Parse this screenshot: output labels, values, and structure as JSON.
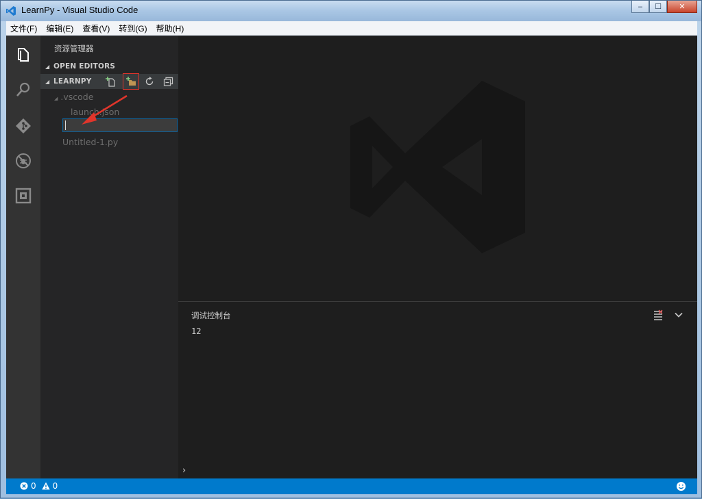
{
  "window": {
    "title": "LearnPy - Visual Studio Code",
    "controls": {
      "minimize": "‒",
      "maximize": "☐",
      "close": "✕"
    }
  },
  "menubar": [
    "文件(F)",
    "编辑(E)",
    "查看(V)",
    "转到(G)",
    "帮助(H)"
  ],
  "activitybar": [
    "explorer-icon",
    "search-icon",
    "git-icon",
    "debug-icon",
    "extensions-icon"
  ],
  "sidebar": {
    "header": "资源管理器",
    "open_editors_label": "OPEN EDITORS",
    "explorer_label": "LEARNPY",
    "tools": [
      "new-file-icon",
      "new-folder-icon",
      "refresh-icon",
      "collapse-all-icon"
    ],
    "tree": [
      {
        "label": ".vscode",
        "type": "folder"
      },
      {
        "label": "launch.json",
        "type": "file"
      },
      {
        "label": "Untitled-1.py",
        "type": "file"
      }
    ],
    "rename_value": ""
  },
  "panel": {
    "title": "调试控制台",
    "output": "12",
    "prompt": "›"
  },
  "statusbar": {
    "errors": "0",
    "warnings": "0"
  },
  "colors": {
    "accent": "#007acc",
    "activitybar": "#333333",
    "sidebar": "#252526",
    "editor": "#1e1e1e",
    "annotation": "#e0352b"
  }
}
